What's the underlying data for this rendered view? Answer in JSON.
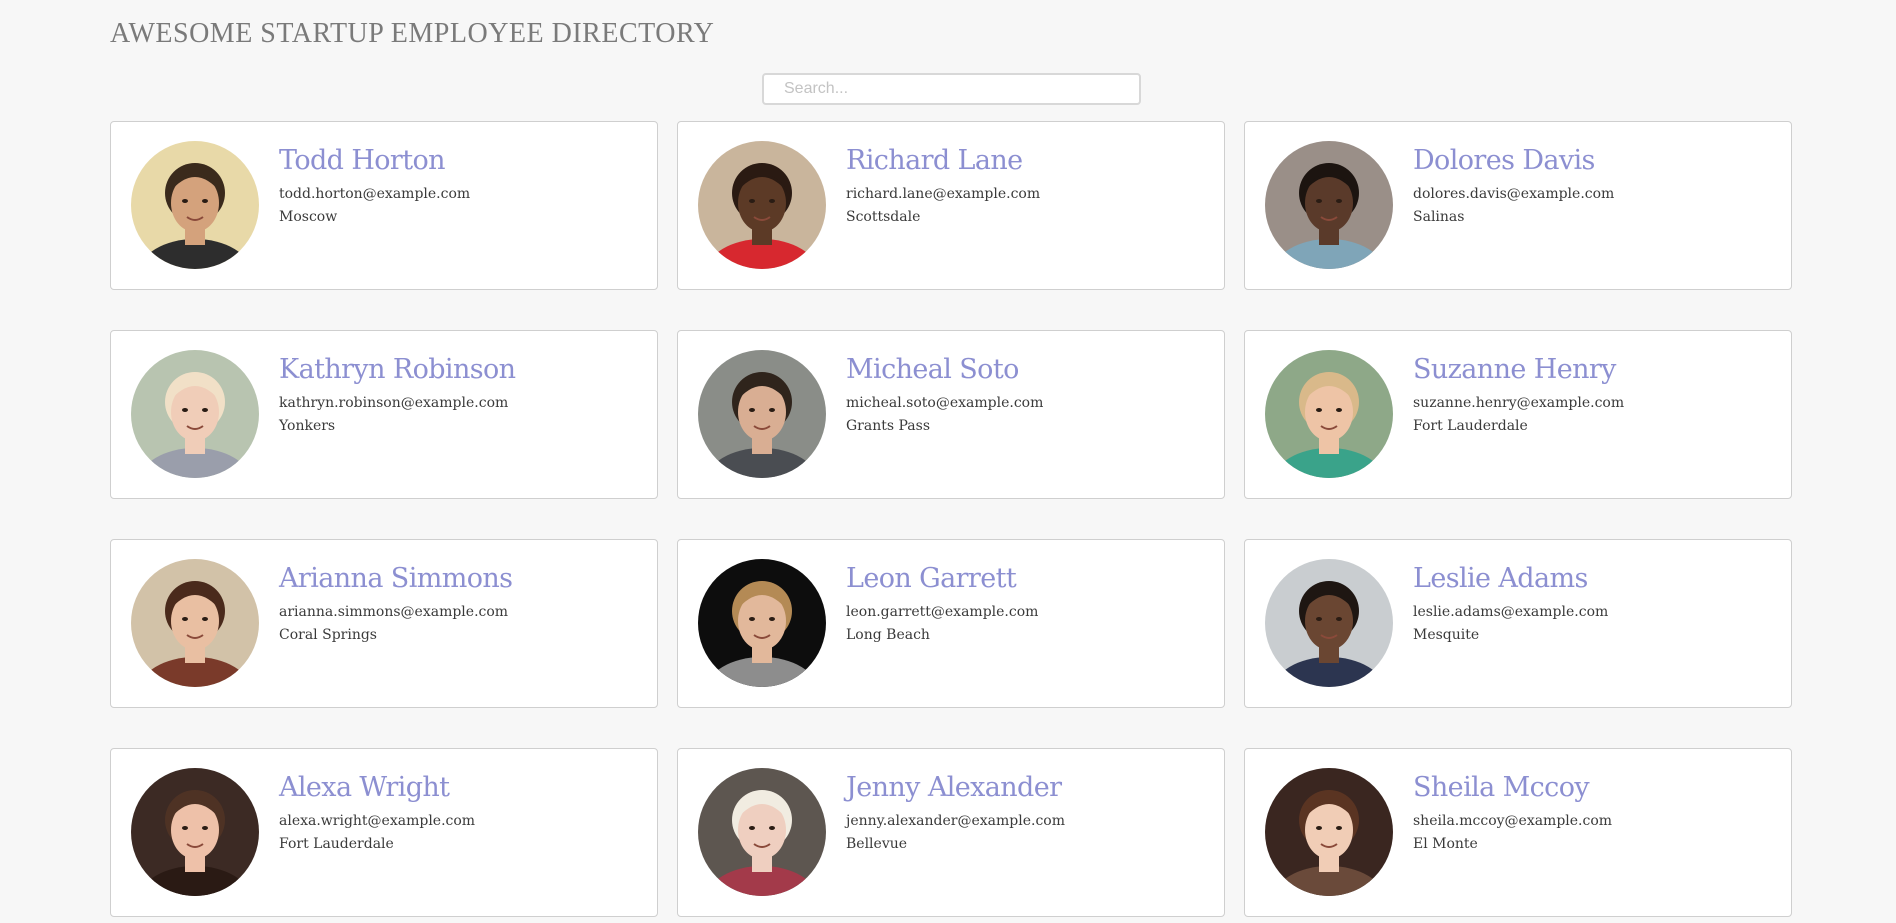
{
  "header": {
    "title": "AWESOME STARTUP EMPLOYEE DIRECTORY"
  },
  "search": {
    "placeholder": "Search..."
  },
  "employees": [
    {
      "name": "Todd Horton",
      "email": "todd.horton@example.com",
      "city": "Moscow",
      "avatar": {
        "bg": "#e8d9a8",
        "skin": "#d4a27c",
        "hair": "#3a2a1c",
        "shirt": "#2d2d2d"
      }
    },
    {
      "name": "Richard Lane",
      "email": "richard.lane@example.com",
      "city": "Scottsdale",
      "avatar": {
        "bg": "#c9b59c",
        "skin": "#5c3a26",
        "hair": "#2a1a12",
        "shirt": "#d7282f"
      }
    },
    {
      "name": "Dolores Davis",
      "email": "dolores.davis@example.com",
      "city": "Salinas",
      "avatar": {
        "bg": "#9a8f88",
        "skin": "#5a3a2a",
        "hair": "#1c1410",
        "shirt": "#7fa5b8"
      }
    },
    {
      "name": "Kathryn Robinson",
      "email": "kathryn.robinson@example.com",
      "city": "Yonkers",
      "avatar": {
        "bg": "#b8c4b0",
        "skin": "#f0cdb8",
        "hair": "#f1e0c7",
        "shirt": "#9a9eab"
      }
    },
    {
      "name": "Micheal Soto",
      "email": "micheal.soto@example.com",
      "city": "Grants Pass",
      "avatar": {
        "bg": "#8a8d88",
        "skin": "#d9ae93",
        "hair": "#2f241c",
        "shirt": "#4a4d52"
      }
    },
    {
      "name": "Suzanne Henry",
      "email": "suzanne.henry@example.com",
      "city": "Fort Lauderdale",
      "avatar": {
        "bg": "#8ea888",
        "skin": "#eec4a6",
        "hair": "#d9b98a",
        "shirt": "#3aa38a"
      }
    },
    {
      "name": "Arianna Simmons",
      "email": "arianna.simmons@example.com",
      "city": "Coral Springs",
      "avatar": {
        "bg": "#d2c2a8",
        "skin": "#e9bfa2",
        "hair": "#4a2a1c",
        "shirt": "#7a3a2a"
      }
    },
    {
      "name": "Leon Garrett",
      "email": "leon.garrett@example.com",
      "city": "Long Beach",
      "avatar": {
        "bg": "#0d0d0d",
        "skin": "#e2b89b",
        "hair": "#b48a55",
        "shirt": "#8d8d8d"
      }
    },
    {
      "name": "Leslie Adams",
      "email": "leslie.adams@example.com",
      "city": "Mesquite",
      "avatar": {
        "bg": "#c9cdd0",
        "skin": "#6a4632",
        "hair": "#1e1612",
        "shirt": "#2c3550"
      }
    },
    {
      "name": "Alexa Wright",
      "email": "alexa.wright@example.com",
      "city": "Fort Lauderdale",
      "avatar": {
        "bg": "#3c2a24",
        "skin": "#eec1a9",
        "hair": "#4e3224",
        "shirt": "#2a1a14"
      }
    },
    {
      "name": "Jenny Alexander",
      "email": "jenny.alexander@example.com",
      "city": "Bellevue",
      "avatar": {
        "bg": "#5d5650",
        "skin": "#efcfc0",
        "hair": "#f1ece1",
        "shirt": "#a33a4a"
      }
    },
    {
      "name": "Sheila Mccoy",
      "email": "sheila.mccoy@example.com",
      "city": "El Monte",
      "avatar": {
        "bg": "#3a2620",
        "skin": "#f1cdb6",
        "hair": "#5a3422",
        "shirt": "#6a4a3a"
      }
    }
  ]
}
